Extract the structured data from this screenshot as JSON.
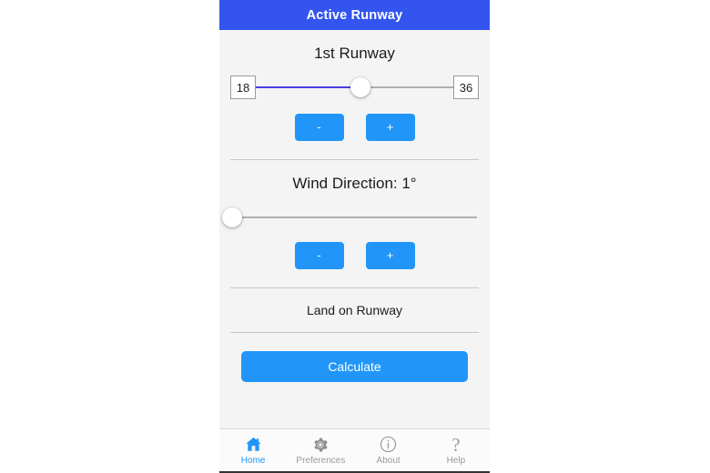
{
  "app": {
    "title": "Active Runway"
  },
  "runway_section": {
    "title": "1st Runway",
    "slider": {
      "min_label": "18",
      "max_label": "36",
      "value_percent": 53
    },
    "decrement_label": "-",
    "increment_label": "+"
  },
  "wind_section": {
    "title": "Wind Direction: 1°",
    "slider": {
      "value_percent": 0
    },
    "decrement_label": "-",
    "increment_label": "+"
  },
  "result_section": {
    "label": "Land on Runway"
  },
  "actions": {
    "calculate_label": "Calculate"
  },
  "tabs": [
    {
      "label": "Home",
      "icon": "home-icon",
      "active": true
    },
    {
      "label": "Preferences",
      "icon": "gear-icon",
      "active": false
    },
    {
      "label": "About",
      "icon": "info-circle-icon",
      "active": false
    },
    {
      "label": "Help",
      "icon": "question-mark-icon",
      "active": false
    }
  ],
  "colors": {
    "title_bar": "#3355ee",
    "button_blue": "#2196f8",
    "slider_active": "#4b3ce0",
    "panel_background": "#f4f4f4"
  }
}
